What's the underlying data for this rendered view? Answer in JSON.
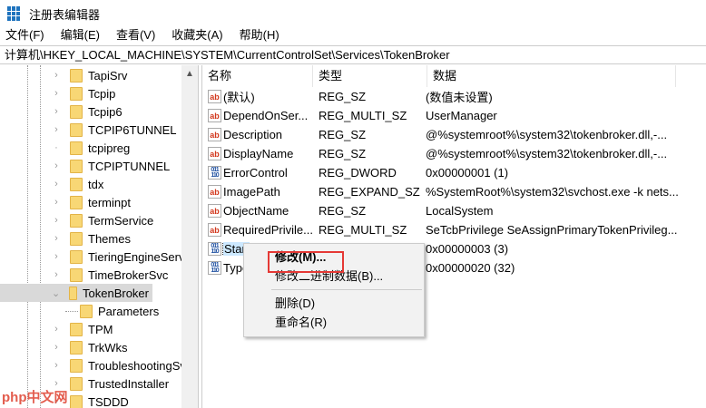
{
  "window": {
    "title": "注册表编辑器"
  },
  "menubar": [
    "文件(F)",
    "编辑(E)",
    "查看(V)",
    "收藏夹(A)",
    "帮助(H)"
  ],
  "address": "计算机\\HKEY_LOCAL_MACHINE\\SYSTEM\\CurrentControlSet\\Services\\TokenBroker",
  "tree": [
    {
      "label": "TapiSrv",
      "expandable": true
    },
    {
      "label": "Tcpip",
      "expandable": true
    },
    {
      "label": "Tcpip6",
      "expandable": true
    },
    {
      "label": "TCPIP6TUNNEL",
      "expandable": true
    },
    {
      "label": "tcpipreg",
      "expandable": false
    },
    {
      "label": "TCPIPTUNNEL",
      "expandable": true
    },
    {
      "label": "tdx",
      "expandable": true
    },
    {
      "label": "terminpt",
      "expandable": true
    },
    {
      "label": "TermService",
      "expandable": true
    },
    {
      "label": "Themes",
      "expandable": true
    },
    {
      "label": "TieringEngineService",
      "expandable": true
    },
    {
      "label": "TimeBrokerSvc",
      "expandable": true
    },
    {
      "label": "TokenBroker",
      "expandable": true,
      "expanded": true,
      "selected": true
    },
    {
      "label": "Parameters",
      "child": true
    },
    {
      "label": "TPM",
      "expandable": true
    },
    {
      "label": "TrkWks",
      "expandable": true
    },
    {
      "label": "TroubleshootingSvc",
      "expandable": true
    },
    {
      "label": "TrustedInstaller",
      "expandable": true
    },
    {
      "label": "TSDDD",
      "expandable": true
    }
  ],
  "columns": [
    "名称",
    "类型",
    "数据"
  ],
  "values": [
    {
      "name": "(默认)",
      "type": "REG_SZ",
      "data": "(数值未设置)",
      "icon": "ab"
    },
    {
      "name": "DependOnSer...",
      "type": "REG_MULTI_SZ",
      "data": "UserManager",
      "icon": "ab"
    },
    {
      "name": "Description",
      "type": "REG_SZ",
      "data": "@%systemroot%\\system32\\tokenbroker.dll,-...",
      "icon": "ab"
    },
    {
      "name": "DisplayName",
      "type": "REG_SZ",
      "data": "@%systemroot%\\system32\\tokenbroker.dll,-...",
      "icon": "ab"
    },
    {
      "name": "ErrorControl",
      "type": "REG_DWORD",
      "data": "0x00000001 (1)",
      "icon": "bin"
    },
    {
      "name": "ImagePath",
      "type": "REG_EXPAND_SZ",
      "data": "%SystemRoot%\\system32\\svchost.exe -k nets...",
      "icon": "ab"
    },
    {
      "name": "ObjectName",
      "type": "REG_SZ",
      "data": "LocalSystem",
      "icon": "ab"
    },
    {
      "name": "RequiredPrivile...",
      "type": "REG_MULTI_SZ",
      "data": "SeTcbPrivilege SeAssignPrimaryTokenPrivileg...",
      "icon": "ab"
    },
    {
      "name": "Start",
      "type": "",
      "data": "0x00000003 (3)",
      "icon": "bin",
      "selected": true
    },
    {
      "name": "Type",
      "type": "",
      "data": "0x00000020 (32)",
      "icon": "bin"
    }
  ],
  "context_menu": {
    "modify": "修改(M)...",
    "modify_binary": "修改二进制数据(B)...",
    "delete": "删除(D)",
    "rename": "重命名(R)"
  },
  "watermark": "php中文网"
}
